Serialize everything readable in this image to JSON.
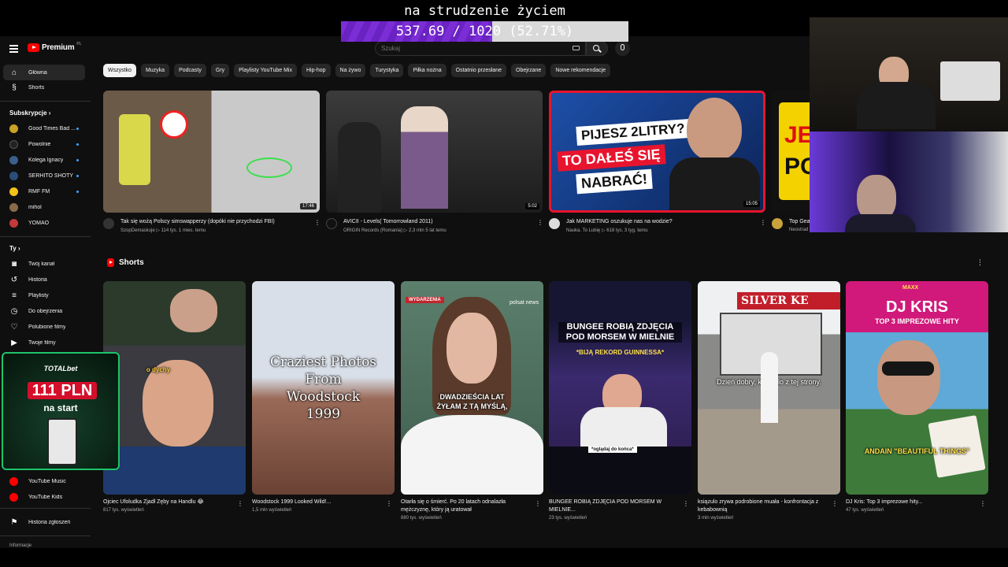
{
  "overlay": {
    "title": "na strudzenie życiem",
    "progress_text": "537.69 / 1020 (52.71%)",
    "progress_fraction": 0.5271
  },
  "header": {
    "logo_text": "Premium",
    "logo_sup": "PL",
    "search_placeholder": "Szukaj"
  },
  "sidebar": {
    "main": [
      {
        "label": "Główna",
        "icon": "home-icon"
      },
      {
        "label": "Shorts",
        "icon": "shorts-icon"
      }
    ],
    "subscriptions_heading": "Subskrypcje",
    "subscriptions": [
      {
        "label": "Good Times Bad ...",
        "color": "#c9a227"
      },
      {
        "label": "Powolnie",
        "color": "#111111"
      },
      {
        "label": "Kolega Ignacy",
        "color": "#3a5f8a"
      },
      {
        "label": "SERHITO SHOTY",
        "color": "#2c4d7a"
      },
      {
        "label": "RMF FM",
        "color": "#f2c21a"
      },
      {
        "label": "mihol",
        "color": "#8a6a4a"
      },
      {
        "label": "YOMAO",
        "color": "#c23a3a"
      }
    ],
    "you_heading": "Ty",
    "you": [
      {
        "label": "Twój kanał",
        "icon": "channel-icon"
      },
      {
        "label": "Historia",
        "icon": "history-icon"
      },
      {
        "label": "Playlisty",
        "icon": "playlist-icon"
      },
      {
        "label": "Do obejrzenia",
        "icon": "clock-icon"
      },
      {
        "label": "Polubione filmy",
        "icon": "like-icon"
      },
      {
        "label": "Twoje filmy",
        "icon": "video-icon"
      }
    ],
    "more": [
      {
        "label": "YouTube Music"
      },
      {
        "label": "YouTube Kids"
      }
    ],
    "report_history": "Historia zgłoszeń",
    "info": "Informacje"
  },
  "chips": [
    "Wszystko",
    "Muzyka",
    "Podcasty",
    "Gry",
    "Playlisty YouTube Mix",
    "Hip-hop",
    "Na żywo",
    "Turystyka",
    "Piłka nożna",
    "Ostatnio przesłane",
    "Obejrzane",
    "Nowe rekomendacje"
  ],
  "videos": [
    {
      "title": "Tak się wożą Polscy simswapperzy (dopóki nie przychodzi FBI)",
      "channel": "SzopDemaskuje",
      "meta": "▷ 114 tys.  1 mies. temu",
      "duration": "17:46"
    },
    {
      "title": "AVICII - Levels( Tomorrowland 2011)",
      "channel": "ORIGIN Records (Romania)",
      "meta": "▷ 2,3 mln  5 lat temu",
      "duration": "5:02"
    },
    {
      "title": "Jak MARKETING oszukuje nas na wodzie?",
      "channel": "Nauka. To Lubię",
      "meta": "▷ 618 tys.  3 tyg. temu",
      "duration": "15:05",
      "thumb_text_1": "PIJESZ 2LITRY?",
      "thumb_text_2": "TO DAŁEŚ SIĘ",
      "thumb_text_3": "NABRAĆ!"
    },
    {
      "title": "Top Gea",
      "channel": "Neostrad",
      "meta": "",
      "duration": "",
      "thumb_text_1": "JE",
      "thumb_text_2": "PO"
    }
  ],
  "shorts_heading": "Shorts",
  "shorts": [
    {
      "title": "Ojciec Ufoludka Zjadł Zęby na Handlu 😂",
      "views": "817 tys. wyświetleń",
      "caption": "o dychy"
    },
    {
      "title": "Woodstock 1999 Looked Wild!...",
      "views": "1,5 mln wyświetleń",
      "caption": "Craziest Photos From Woodstock 1999"
    },
    {
      "title": "Otarła się o śmierć. Po 20 latach odnalazła mężczyznę, który ją uratował",
      "views": "880 tys. wyświetleń",
      "caption": "DWADZIEŚCIA LAT ŻYŁAM Z TĄ MYŚLĄ,",
      "badge": "WYDARZENIA",
      "badge2": "polsat news"
    },
    {
      "title": "BUNGEE ROBIĄ ZDJĘCIA POD MORSEM W MIELNIE...",
      "views": "23 tys. wyświetleń",
      "caption": "BUNGEE ROBIĄ ZDJĘCIA POD MORSEM W MIELNIE",
      "caption2": "*BIJĄ REKORD GUINNESSA*",
      "caption3": "*oglądaj do końca*"
    },
    {
      "title": "ksiązulo zrywa podrobione muała - konfrontacja z kebabownią",
      "views": "3 mln wyświetleń",
      "caption": "Dzień dobry, ksiązulo z tej strony.",
      "sign": "SILVER KE"
    },
    {
      "title": "DJ Kris: Top 3 imprezowe hity...",
      "views": "47 tys. wyświetleń",
      "caption": "DJ KRIS",
      "caption2": "TOP 3 IMPREZOWE HITY",
      "caption3": "ANDAIN \"BEAUTIFUL THINGS\"",
      "badge": "MAXX"
    }
  ],
  "ad": {
    "brand": "TOTALbet",
    "amount": "111 PLN",
    "subtitle": "na start"
  }
}
